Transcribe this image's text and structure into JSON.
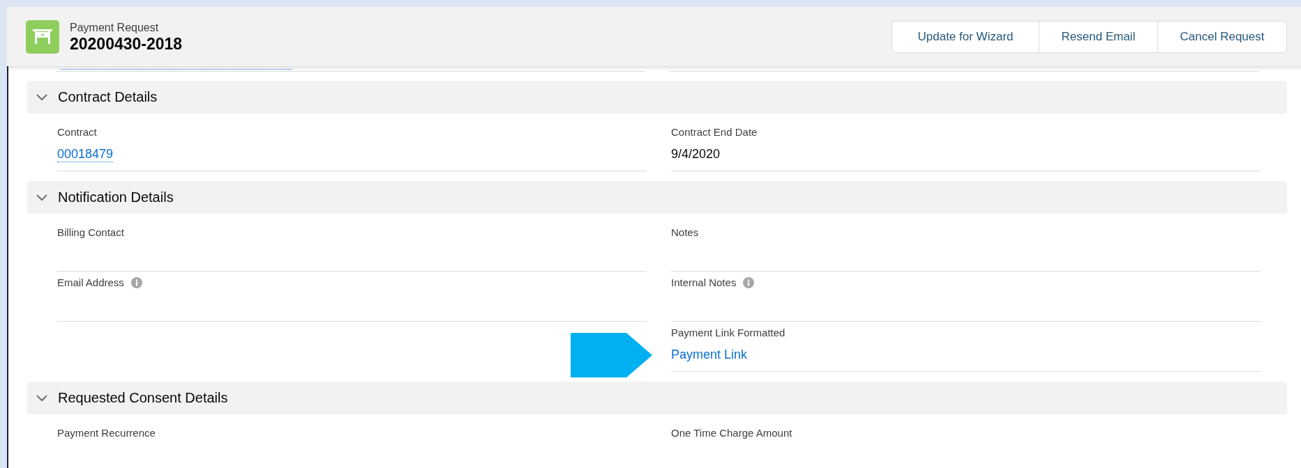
{
  "header": {
    "object_type": "Payment Request",
    "record_name": "20200430-2018"
  },
  "actions": [
    "Update for Wizard",
    "Resend Email",
    "Cancel Request"
  ],
  "sections": [
    {
      "title": "Contract Details",
      "expanded": true,
      "rows": [
        [
          {
            "kind": "link",
            "label": "Contract",
            "value": "00018479"
          },
          {
            "kind": "text",
            "label": "Contract End Date",
            "value": "9/4/2020"
          }
        ]
      ]
    },
    {
      "title": "Notification Details",
      "expanded": true,
      "rows": [
        [
          {
            "kind": "text",
            "label": "Billing Contact"
          },
          {
            "kind": "text",
            "label": "Notes"
          }
        ],
        [
          {
            "kind": "text",
            "label": "Email Address",
            "info": true
          },
          {
            "kind": "text",
            "label": "Internal Notes",
            "info": true
          }
        ],
        [
          {
            "kind": "empty"
          },
          {
            "kind": "link",
            "label": "Payment Link Formatted",
            "value": "Payment Link"
          }
        ]
      ]
    },
    {
      "title": "Requested Consent Details",
      "expanded": true,
      "rows": [
        [
          {
            "kind": "text",
            "label": "Payment Recurrence"
          },
          {
            "kind": "text",
            "label": "One Time Charge Amount"
          }
        ]
      ]
    }
  ]
}
